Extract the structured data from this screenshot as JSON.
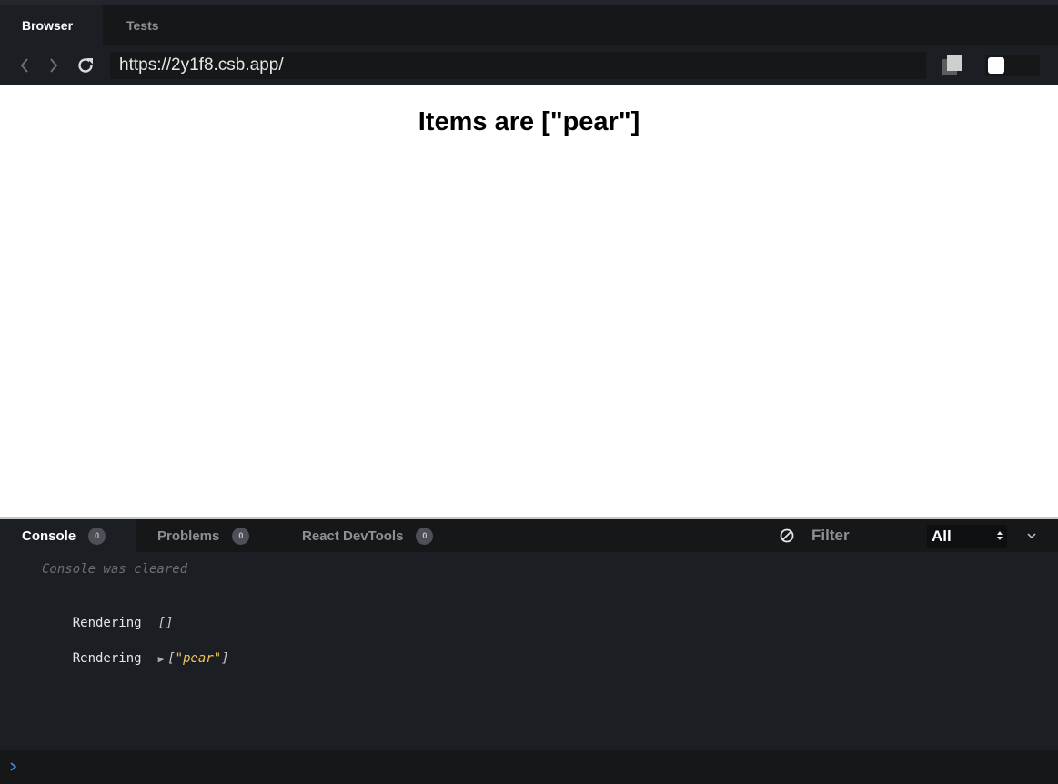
{
  "tabs": [
    {
      "label": "Browser",
      "active": true
    },
    {
      "label": "Tests",
      "active": false
    }
  ],
  "address_bar": {
    "url": "https://2y1f8.csb.app/",
    "icons": [
      "back-arrow-icon",
      "forward-arrow-icon",
      "reload-icon",
      "copy-icon",
      "toggle-switch"
    ]
  },
  "preview": {
    "heading": "Items are [\"pear\"]"
  },
  "console": {
    "tabs": [
      {
        "label": "Console",
        "count": "0",
        "active": true
      },
      {
        "label": "Problems",
        "count": "0",
        "active": false
      },
      {
        "label": "React DevTools",
        "count": "0",
        "active": false
      }
    ],
    "filter_placeholder": "Filter",
    "level_select": "All",
    "messages": [
      {
        "type": "info",
        "text": "Console was cleared"
      },
      {
        "type": "log",
        "label": "Rendering",
        "value": "[]"
      },
      {
        "type": "log",
        "label": "Rendering",
        "expander": "▶",
        "bracket_open": "[",
        "string": "\"pear\"",
        "bracket_close": "]"
      }
    ],
    "prompt": "›"
  },
  "colors": {
    "chrome_bg": "#151719",
    "panel_bg": "#1b1e23",
    "string_value": "#f4c35e",
    "prompt": "#4a8fe2"
  }
}
